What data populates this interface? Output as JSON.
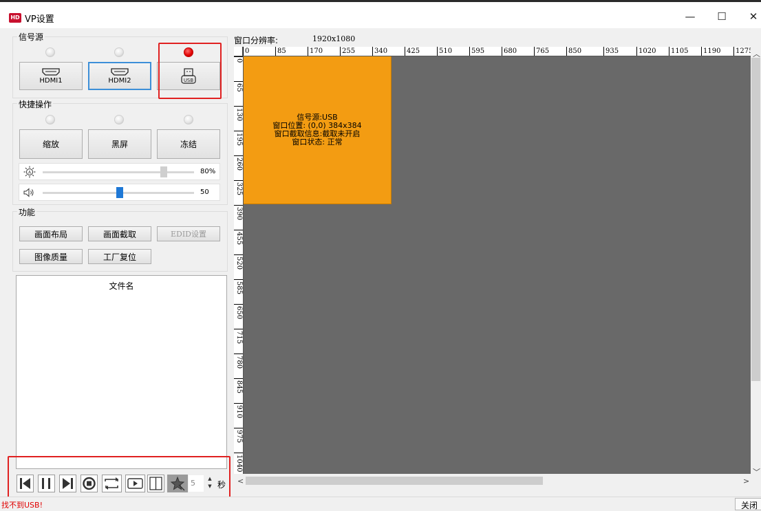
{
  "window": {
    "title": "VP设置",
    "logo": "HD",
    "minimize_label": "—",
    "maximize_label": "☐",
    "close_label": "✕"
  },
  "signal_source": {
    "title": "信号源",
    "sources": [
      {
        "label": "HDMI1",
        "active": false,
        "led": "off"
      },
      {
        "label": "HDMI2",
        "active": true,
        "led": "off"
      },
      {
        "label": "USB",
        "active": false,
        "led": "red"
      }
    ]
  },
  "quick_ops": {
    "title": "快捷操作",
    "buttons": [
      {
        "label": "缩放"
      },
      {
        "label": "黑屏"
      },
      {
        "label": "冻结"
      }
    ],
    "brightness": {
      "value": 80,
      "display": "80%"
    },
    "volume": {
      "value": 50,
      "display": "50"
    }
  },
  "functions": {
    "title": "功能",
    "buttons": [
      {
        "label": "画面布局",
        "enabled": true
      },
      {
        "label": "画面截取",
        "enabled": true
      },
      {
        "label": "EDID设置",
        "enabled": false
      },
      {
        "label": "图像质量",
        "enabled": true
      },
      {
        "label": "工厂复位",
        "enabled": true
      }
    ]
  },
  "file_list": {
    "header": "文件名",
    "items": []
  },
  "playback": {
    "interval_value": "5",
    "interval_unit": "秒",
    "spin_up": "▲",
    "spin_down": "▼"
  },
  "canvas": {
    "resolution_label": "窗口分辨率:",
    "resolution_value": "1920x1080",
    "ruler_x": [
      "0",
      "85",
      "170",
      "255",
      "340",
      "425",
      "510",
      "595",
      "680",
      "765",
      "850",
      "935",
      "1020",
      "1105",
      "1190",
      "1275"
    ],
    "ruler_y": [
      "0",
      "65",
      "130",
      "195",
      "260",
      "325",
      "390",
      "455",
      "520",
      "585",
      "650",
      "715",
      "780",
      "845",
      "910",
      "975",
      "1040"
    ],
    "window_block": {
      "color": "#f39c12",
      "lines": [
        "信号源:USB",
        "窗口位置: (0,0) 384x384",
        "窗口截取信息:截取未开启",
        "窗口状态: 正常"
      ]
    },
    "background_color": "#696969"
  },
  "status": {
    "message": "找不到USB!",
    "close_label": "关闭"
  }
}
